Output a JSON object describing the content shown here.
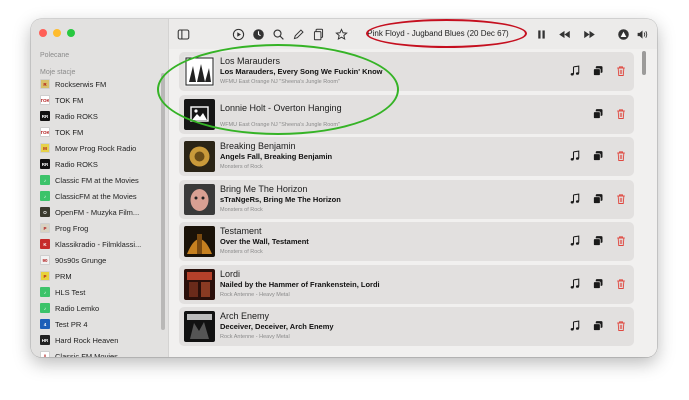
{
  "toolbar": {
    "now_playing": "Pink Floyd - Jugband Blues (20 Dec 67)"
  },
  "sidebar": {
    "section_recommended": "Polecane",
    "section_my_stations": "Moje stacje",
    "items": [
      {
        "label": "Rockserwis FM",
        "icon": "rs",
        "bg": "#d8c06a",
        "glyph": "R"
      },
      {
        "label": "TOK FM",
        "icon": "tok",
        "bg": "#ffffff",
        "glyph": "TOK"
      },
      {
        "label": "Radio ROKS",
        "icon": "roks",
        "bg": "#111111",
        "glyph": "RR"
      },
      {
        "label": "TOK FM",
        "icon": "tok",
        "bg": "#ffffff",
        "glyph": "TOK"
      },
      {
        "label": "Morow Prog Rock Radio",
        "icon": "morow",
        "bg": "#e6d24a",
        "glyph": "M"
      },
      {
        "label": "Radio ROKS",
        "icon": "roks",
        "bg": "#111111",
        "glyph": "RR"
      },
      {
        "label": "Classic FM at the Movies",
        "icon": "note",
        "bg": "#3cc36a",
        "glyph": "♪"
      },
      {
        "label": "ClassicFM at the Movies",
        "icon": "note",
        "bg": "#3cc36a",
        "glyph": "♪"
      },
      {
        "label": "OpenFM - Muzyka Film...",
        "icon": "openfm",
        "bg": "#3a3a2e",
        "glyph": "O"
      },
      {
        "label": "Prog Frog",
        "icon": "frog",
        "bg": "#d9d2c2",
        "glyph": "P"
      },
      {
        "label": "Klassikradio - Filmklassi...",
        "icon": "klassik",
        "bg": "#c62a2a",
        "glyph": "K"
      },
      {
        "label": "90s90s Grunge",
        "icon": "90s",
        "bg": "#f2f2f2",
        "glyph": "90"
      },
      {
        "label": "PRM",
        "icon": "prm",
        "bg": "#e8d23c",
        "glyph": "P"
      },
      {
        "label": "HLS Test",
        "icon": "note",
        "bg": "#3cc36a",
        "glyph": "♪"
      },
      {
        "label": "Radio Lemko",
        "icon": "note",
        "bg": "#3cc36a",
        "glyph": "♪"
      },
      {
        "label": "Test PR 4",
        "icon": "pr4",
        "bg": "#1d5fb8",
        "glyph": "4"
      },
      {
        "label": "Hard Rock Heaven",
        "icon": "hrh",
        "bg": "#222222",
        "glyph": "HR"
      },
      {
        "label": "Classic FM Movies",
        "icon": "cfm",
        "bg": "#ffffff",
        "glyph": "/\\"
      }
    ]
  },
  "rows": [
    {
      "station": "Los Marauders",
      "song": "Los Marauders, Every Song We Fuckin' Know",
      "sub": "WFMU East Orange NJ \"Sheena's Jungle Room\"",
      "art": "marauders",
      "music": true
    },
    {
      "station": "Lonnie Holt - Overton Hanging",
      "song": "",
      "sub": "WFMU East Orange NJ \"Sheena's Jungle Room\"",
      "art": "placeholder",
      "music": false
    },
    {
      "station": "Breaking Benjamin",
      "song": "Angels Fall, Breaking Benjamin",
      "sub": "Monsters of Rock",
      "art": "benjamin",
      "music": true
    },
    {
      "station": "Bring Me The Horizon",
      "song": "sTraNgeRs, Bring Me The Horizon",
      "sub": "Monsters of Rock",
      "art": "bmth",
      "music": true
    },
    {
      "station": "Testament",
      "song": "Over the Wall, Testament",
      "sub": "Monsters of Rock",
      "art": "testament",
      "music": true
    },
    {
      "station": "Lordi",
      "song": "Nailed by the Hammer of Frankenstein, Lordi",
      "sub": "Rock Antenne - Heavy Metal",
      "art": "lordi",
      "music": true
    },
    {
      "station": "Arch Enemy",
      "song": "Deceiver, Deceiver, Arch Enemy",
      "sub": "Rock Antenne - Heavy Metal",
      "art": "archenemy",
      "music": true
    }
  ],
  "colors": {
    "delete_red": "#e0473f",
    "annotation_red": "#c50f1f",
    "annotation_green": "#35b326"
  }
}
